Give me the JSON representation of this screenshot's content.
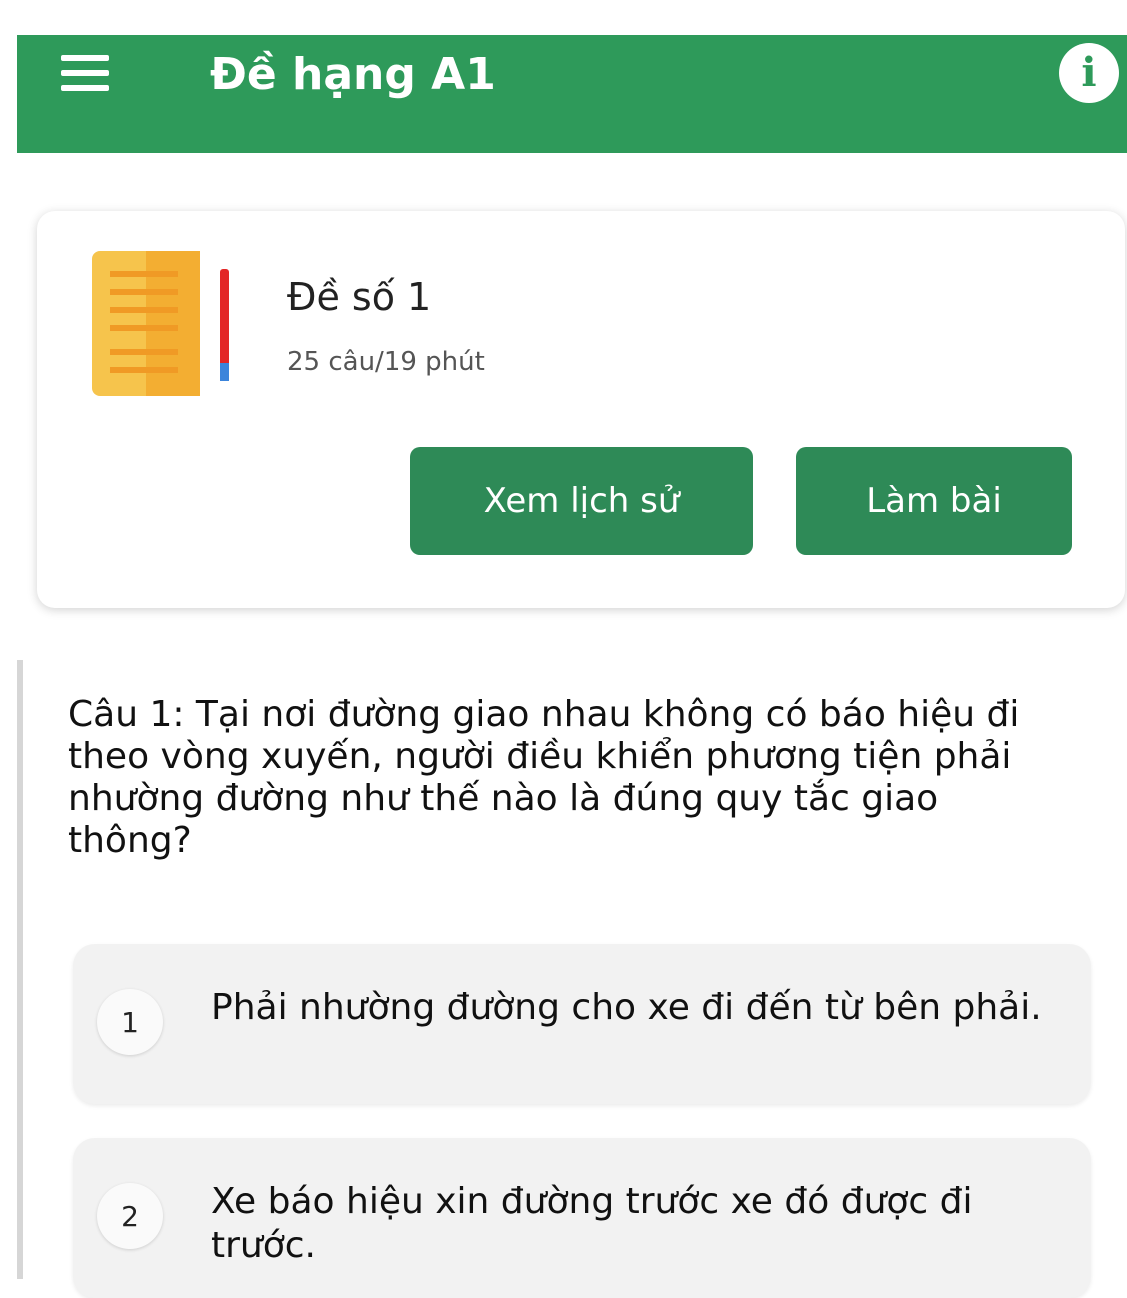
{
  "appbar": {
    "title": "Đề hạng A1",
    "menu_icon": "menu-icon",
    "info_icon": "info-icon",
    "color": "#2e9a5a"
  },
  "exam": {
    "title": "Đề số 1",
    "meta": "25 câu/19 phút",
    "icon": "document-icon",
    "history_label": "Xem lịch sử",
    "start_label": "Làm bài",
    "button_color": "#2e8a57"
  },
  "question": {
    "text": "Câu 1: Tại nơi đường giao nhau không có báo hiệu đi theo vòng xuyến, người điều khiển phương tiện phải nhường đường như thế nào là đúng quy tắc giao thông?",
    "options": [
      {
        "number": "1",
        "text": "Phải nhường đường cho xe đi đến từ bên phải."
      },
      {
        "number": "2",
        "text": "Xe báo hiệu xin đường trước xe đó được đi trước."
      }
    ]
  }
}
